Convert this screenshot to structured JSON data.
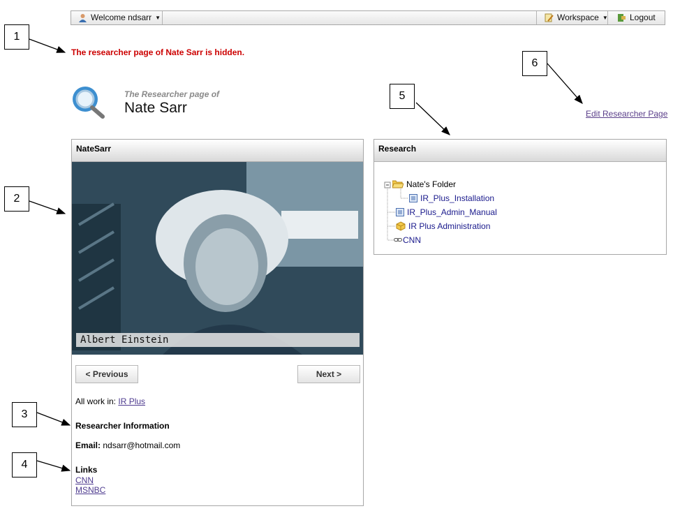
{
  "topbar": {
    "welcome_label": "Welcome ndsarr",
    "workspace_label": "Workspace",
    "logout_label": "Logout"
  },
  "callouts": [
    "1",
    "2",
    "3",
    "4",
    "5",
    "6"
  ],
  "hidden_message": "The researcher page of Nate Sarr is hidden.",
  "researcher": {
    "subtitle": "The Researcher page of",
    "name": "Nate Sarr"
  },
  "edit_link": "Edit Researcher Page",
  "left_panel": {
    "title": "NateSarr",
    "photo_caption": "Albert Einstein",
    "prev_label": "< Previous",
    "next_label": "Next >",
    "all_work_prefix": "All work in:",
    "all_work_link": "IR Plus",
    "info_title": "Researcher Information",
    "email_label": "Email:",
    "email_value": "ndsarr@hotmail.com",
    "links_title": "Links",
    "links": [
      "CNN",
      "MSNBC"
    ]
  },
  "right_panel": {
    "title": "Research",
    "tree": {
      "folder": "Nate's Folder",
      "folder_child": "IR_Plus_Installation",
      "item1": "IR_Plus_Admin_Manual",
      "item2": "IR Plus Administration",
      "item3": "CNN"
    }
  },
  "colors": {
    "hidden_message": "#cc0000",
    "link": "#4e3b8f",
    "tree_link": "#1a1a8c"
  }
}
